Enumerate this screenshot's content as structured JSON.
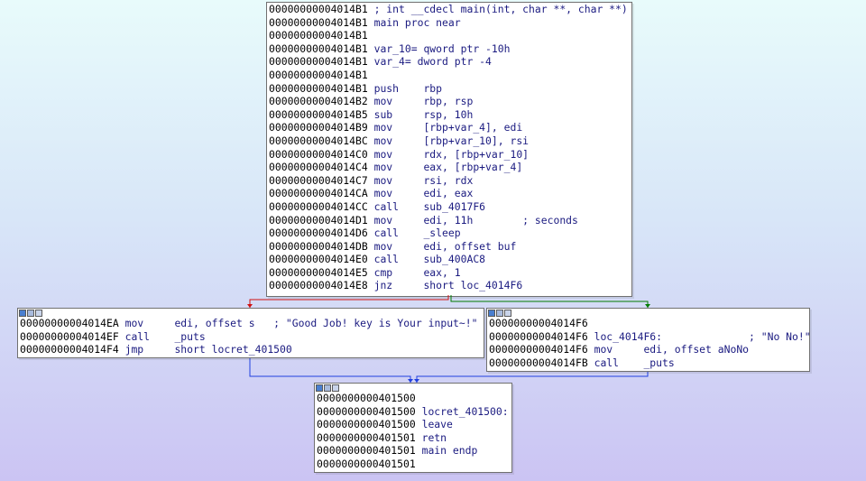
{
  "main_block": {
    "lines": [
      {
        "addr": "00000000004014B1",
        "text": " ; int __cdecl main(int, char **, char **)"
      },
      {
        "addr": "00000000004014B1",
        "text": " main proc near"
      },
      {
        "addr": "00000000004014B1",
        "text": ""
      },
      {
        "addr": "00000000004014B1",
        "text": " var_10= qword ptr -10h"
      },
      {
        "addr": "00000000004014B1",
        "text": " var_4= dword ptr -4"
      },
      {
        "addr": "00000000004014B1",
        "text": ""
      },
      {
        "addr": "00000000004014B1",
        "text": " push    rbp"
      },
      {
        "addr": "00000000004014B2",
        "text": " mov     rbp, rsp"
      },
      {
        "addr": "00000000004014B5",
        "text": " sub     rsp, 10h"
      },
      {
        "addr": "00000000004014B9",
        "text": " mov     [rbp+var_4], edi"
      },
      {
        "addr": "00000000004014BC",
        "text": " mov     [rbp+var_10], rsi"
      },
      {
        "addr": "00000000004014C0",
        "text": " mov     rdx, [rbp+var_10]"
      },
      {
        "addr": "00000000004014C4",
        "text": " mov     eax, [rbp+var_4]"
      },
      {
        "addr": "00000000004014C7",
        "text": " mov     rsi, rdx"
      },
      {
        "addr": "00000000004014CA",
        "text": " mov     edi, eax"
      },
      {
        "addr": "00000000004014CC",
        "text": " call    sub_4017F6"
      },
      {
        "addr": "00000000004014D1",
        "text": " mov     edi, 11h        ; seconds"
      },
      {
        "addr": "00000000004014D6",
        "text": " call    _sleep"
      },
      {
        "addr": "00000000004014DB",
        "text": " mov     edi, offset buf"
      },
      {
        "addr": "00000000004014E0",
        "text": " call    sub_400AC8"
      },
      {
        "addr": "00000000004014E5",
        "text": " cmp     eax, 1"
      },
      {
        "addr": "00000000004014E8",
        "text": " jnz     short loc_4014F6"
      }
    ]
  },
  "good_block": {
    "lines": [
      {
        "addr": "00000000004014EA",
        "text": " mov     edi, offset s   ; \"Good Job! key is Your input~!\""
      },
      {
        "addr": "00000000004014EF",
        "text": " call    _puts"
      },
      {
        "addr": "00000000004014F4",
        "text": " jmp     short locret_401500"
      }
    ]
  },
  "bad_block": {
    "lines": [
      {
        "addr": "00000000004014F6",
        "text": ""
      },
      {
        "addr": "00000000004014F6",
        "text": " loc_4014F6:              ; \"No No!\""
      },
      {
        "addr": "00000000004014F6",
        "text": " mov     edi, offset aNoNo"
      },
      {
        "addr": "00000000004014FB",
        "text": " call    _puts"
      }
    ]
  },
  "end_block": {
    "lines": [
      {
        "addr": "0000000000401500",
        "text": ""
      },
      {
        "addr": "0000000000401500",
        "text": " locret_401500:"
      },
      {
        "addr": "0000000000401500",
        "text": " leave"
      },
      {
        "addr": "0000000000401501",
        "text": " retn"
      },
      {
        "addr": "0000000000401501",
        "text": " main endp"
      },
      {
        "addr": "0000000000401501",
        "text": ""
      }
    ]
  },
  "colors": {
    "edge_false": "#d01010",
    "edge_true": "#007a00",
    "edge_uncond": "#2040e0"
  }
}
